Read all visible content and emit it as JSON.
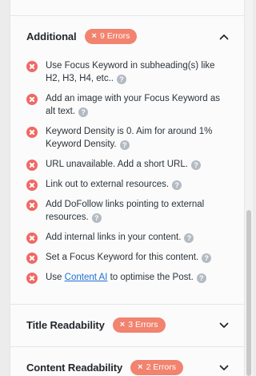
{
  "additional": {
    "title": "Additional",
    "badge": "9 Errors",
    "expanded": true,
    "items": [
      {
        "text": "Use Focus Keyword in subheading(s) like H2, H3, H4, etc.."
      },
      {
        "text": "Add an image with your Focus Keyword as alt text."
      },
      {
        "text": "Keyword Density is 0. Aim for around 1% Keyword Density."
      },
      {
        "text": "URL unavailable. Add a short URL."
      },
      {
        "text": "Link out to external resources."
      },
      {
        "text": "Add DoFollow links pointing to external resources."
      },
      {
        "text": "Add internal links in your content."
      },
      {
        "text": "Set a Focus Keyword for this content."
      },
      {
        "prefix": "Use ",
        "link": "Content AI",
        "suffix": " to optimise the Post."
      }
    ]
  },
  "title_readability": {
    "title": "Title Readability",
    "badge": "3 Errors"
  },
  "content_readability": {
    "title": "Content Readability",
    "badge": "2 Errors"
  },
  "icons": {
    "error": "error-x-circle-icon",
    "help": "question-circle-icon",
    "expand": "chevron-up-icon",
    "collapse": "chevron-down-icon"
  },
  "colors": {
    "badge": "#f1836f",
    "error_icon": "#ef6a64",
    "help_icon": "#b3bac2",
    "link": "#1f6fd1"
  }
}
